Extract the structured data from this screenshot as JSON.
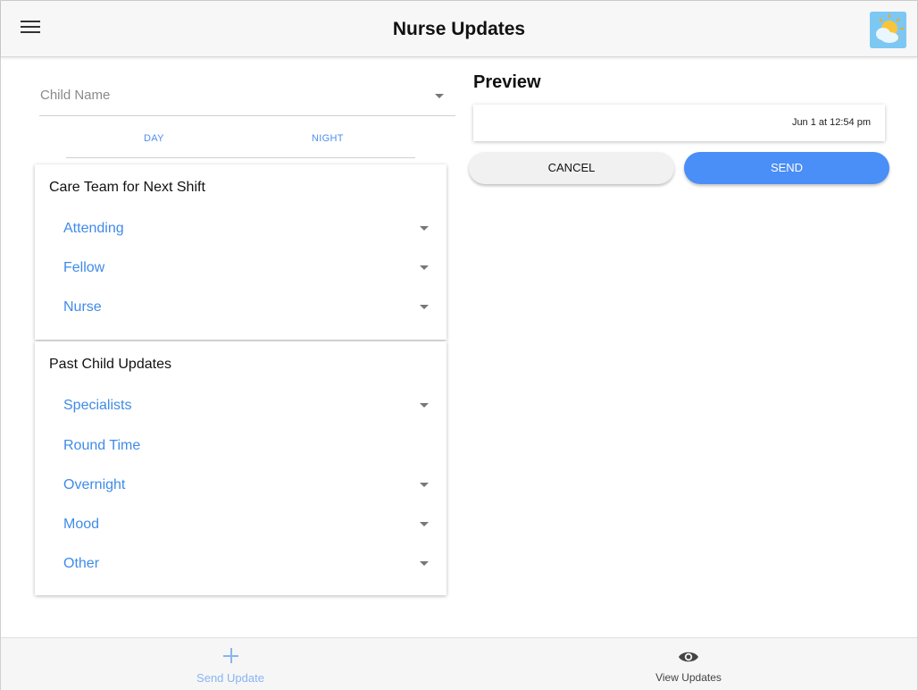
{
  "header": {
    "title": "Nurse Updates",
    "menu_icon": "hamburger-menu-icon",
    "avatar_icon": "sun-cloud-icon"
  },
  "form": {
    "child_name_label": "Child Name",
    "tabs": [
      {
        "label": "DAY"
      },
      {
        "label": "NIGHT"
      }
    ]
  },
  "care_team": {
    "title": "Care Team for Next Shift",
    "items": [
      {
        "label": "Attending"
      },
      {
        "label": "Fellow"
      },
      {
        "label": "Nurse"
      }
    ]
  },
  "past_updates": {
    "title": "Past Child Updates",
    "items": [
      {
        "label": "Specialists"
      },
      {
        "label": "Round Time"
      },
      {
        "label": "Overnight"
      },
      {
        "label": "Mood"
      },
      {
        "label": "Other"
      }
    ]
  },
  "preview": {
    "title": "Preview",
    "timestamp": "Jun 1 at 12:54 pm",
    "cancel_label": "CANCEL",
    "send_label": "SEND"
  },
  "bottom_nav": {
    "items": [
      {
        "label": "Send Update",
        "icon": "plus-icon"
      },
      {
        "label": "View Updates",
        "icon": "eye-icon"
      }
    ]
  },
  "colors": {
    "accent": "#4a8ef7",
    "link": "#3f8be8",
    "inactive_nav": "#8ab4f0"
  }
}
